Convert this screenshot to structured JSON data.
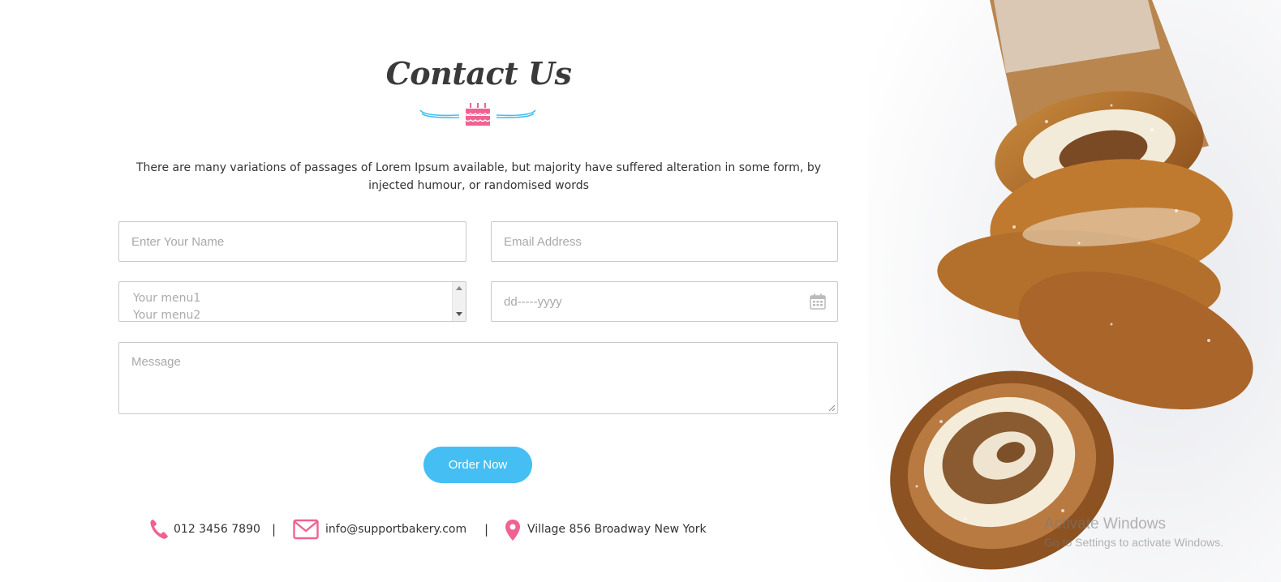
{
  "contact": {
    "title": "Contact Us",
    "intro": "There are many variations of passages of Lorem Ipsum available, but majority have suffered alteration in some form, by injected humour, or randomised words"
  },
  "form": {
    "name_placeholder": "Enter Your Name",
    "email_placeholder": "Email Address",
    "menu_options": [
      "Your menu1",
      "Your menu2"
    ],
    "date_placeholder": "dd-----yyyy",
    "message_placeholder": "Message",
    "submit_label": "Order Now"
  },
  "info": {
    "phone": "012 3456 7890",
    "email": "info@supportbakery.com",
    "address": "Village 856 Broadway New York",
    "separator": "|"
  },
  "watermark": {
    "line1": "Activate Windows",
    "line2": "Go to Settings to activate Windows."
  },
  "colors": {
    "accent_blue": "#45bff3",
    "accent_pink": "#f06292",
    "heading": "#3a3a3a"
  },
  "icons": {
    "divider": "cake-icon",
    "phone": "phone-icon",
    "email": "envelope-icon",
    "address": "map-pin-icon",
    "date": "calendar-icon"
  }
}
